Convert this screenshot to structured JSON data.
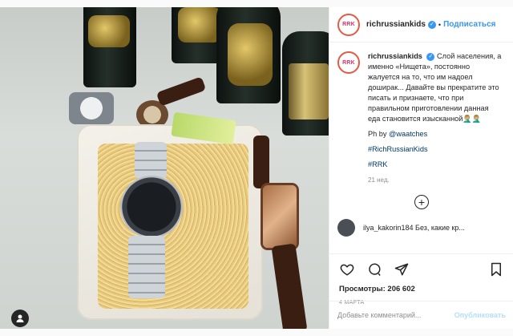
{
  "post": {
    "author": "richrussiankids",
    "avatar_text": "RRK",
    "follow_label": "Подписаться",
    "separator": "•",
    "caption_user": "richrussiankids",
    "caption_text": "Слой населения, а именно «Нищета», постоянно жалуется на то, что им надоел доширак... Давайте вы прекратите это писать и признаете, что при правильном приготовлении данная еда становится изысканной🤦🏼‍♂️🤦🏼‍♂️",
    "ph_by_prefix": "Ph by ",
    "ph_by_handle": "@waatches",
    "hashtag1": "#RichRussianKids",
    "hashtag2": "#RRK",
    "time_ago": "21 нед.",
    "load_more_symbol": "+",
    "partial_comment": "ilya_kakorin184 Без, какие кр...",
    "views_label": "Просмотры: 206 602",
    "date": "4 МАРТА",
    "comment_placeholder": "Добавьте комментарий...",
    "publish_label": "Опубликовать"
  },
  "colors": {
    "accent": "#3897f0",
    "brand": "#e1306c",
    "muted": "#8e8e8e"
  },
  "icons": [
    "heart-icon",
    "comment-icon",
    "share-icon",
    "bookmark-icon",
    "verified-icon",
    "add-comments-icon",
    "user-icon"
  ]
}
